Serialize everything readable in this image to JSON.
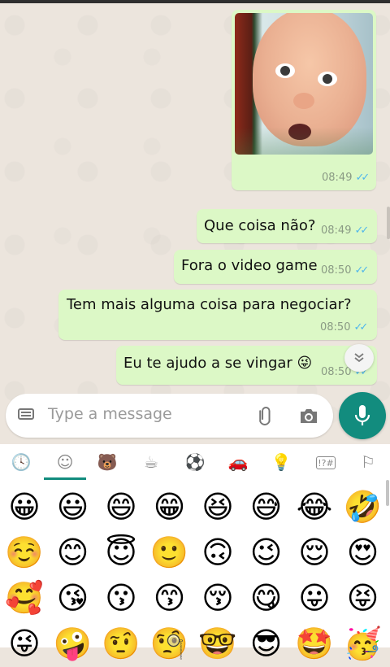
{
  "messages": [
    {
      "text": "Que coisa não?",
      "time": "08:49",
      "ticks": "✓✓"
    },
    {
      "text": "Fora o video game",
      "time": "08:50",
      "ticks": "✓✓"
    },
    {
      "text": "Tem mais alguma coisa para negociar?",
      "time": "08:50",
      "ticks": "✓✓"
    },
    {
      "text": "Eu te ajudo a se vingar 😜",
      "time": "08:50",
      "ticks": "✓✓"
    }
  ],
  "image_message": {
    "time": "08:49",
    "ticks": "✓✓"
  },
  "input": {
    "placeholder": "Type a message"
  },
  "icons": {
    "keyboard": "keyboard-icon",
    "attach": "paperclip-icon",
    "camera": "camera-icon",
    "mic": "mic-icon",
    "scroll_down": "chevron-double-down-icon"
  },
  "emoji_categories": [
    {
      "name": "recent-icon",
      "glyph": "🕓"
    },
    {
      "name": "smileys-icon",
      "glyph": "☺"
    },
    {
      "name": "animals-icon",
      "glyph": "🐻"
    },
    {
      "name": "food-icon",
      "glyph": "☕"
    },
    {
      "name": "activity-icon",
      "glyph": "⚽"
    },
    {
      "name": "travel-icon",
      "glyph": "🚗"
    },
    {
      "name": "objects-icon",
      "glyph": "💡"
    },
    {
      "name": "symbols-icon",
      "glyph": "!?#"
    },
    {
      "name": "flags-icon",
      "glyph": "⚐"
    }
  ],
  "emojis": [
    [
      "😀",
      "😃",
      "😄",
      "😁",
      "😆",
      "😅",
      "😂",
      "🤣"
    ],
    [
      "☺️",
      "😊",
      "😇",
      "🙂",
      "🙃",
      "😉",
      "😌",
      "😍"
    ],
    [
      "🥰",
      "😘",
      "😗",
      "😙",
      "😚",
      "😋",
      "😛",
      "😝"
    ],
    [
      "😜",
      "🤪",
      "🤨",
      "🧐",
      "🤓",
      "😎",
      "🤩",
      "🥳"
    ]
  ],
  "colors": {
    "accent": "#128c7e",
    "outgoing_bubble": "#dcf8c6",
    "chat_background": "#ece5dd",
    "read_ticks": "#4fb6ec"
  }
}
